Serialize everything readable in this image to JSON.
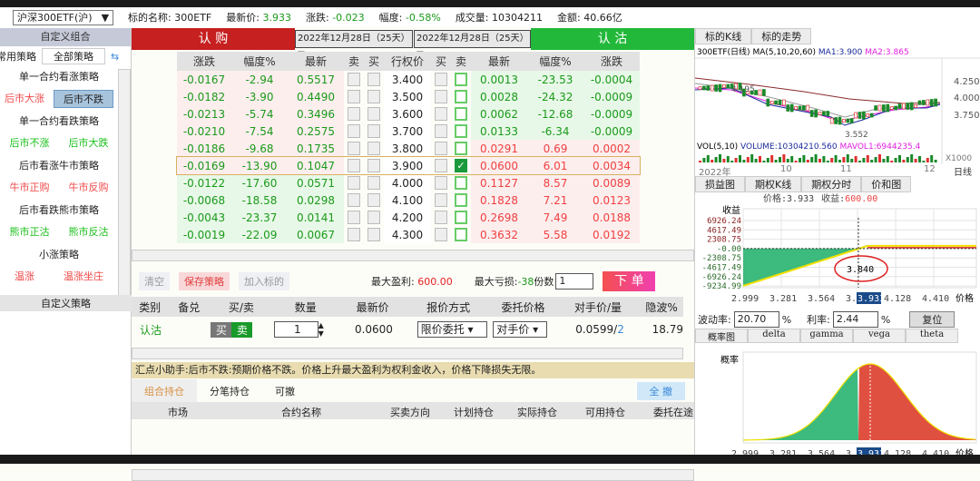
{
  "header": {
    "underlying_select": "沪深300ETF(沪)",
    "name_label": "标的名称:",
    "name": "300ETF",
    "last_label": "最新价:",
    "last": "3.933",
    "chg_label": "涨跌:",
    "chg": "-0.023",
    "pct_label": "幅度:",
    "pct": "-0.58%",
    "vol_label": "成交量:",
    "vol": "10304211",
    "amt_label": "金额:",
    "amt": "40.66亿"
  },
  "left": {
    "title": "自定义组合",
    "tabs": [
      "常用策略",
      "全部策略"
    ],
    "groups": [
      {
        "title": "单一合约看涨策略",
        "items": [
          "后市大涨",
          "后市不跌"
        ]
      },
      {
        "title": "单一合约看跌策略",
        "items": [
          "后市不涨",
          "后市大跌"
        ]
      },
      {
        "title": "后市看涨牛市策略",
        "items": [
          "牛市正购",
          "牛市反购"
        ]
      },
      {
        "title": "后市看跌熊市策略",
        "items": [
          "熊市正沽",
          "熊市反沽"
        ]
      },
      {
        "title": "小涨策略",
        "items": [
          "温涨",
          "温涨坐庄"
        ]
      }
    ],
    "selected": "后市不跌",
    "footer": "自定义策略"
  },
  "chain": {
    "call_label": "认 购",
    "put_label": "认 沽",
    "call_expiry": "2022年12月28日（25天）",
    "put_expiry": "2022年12月28日（25天）",
    "columns": [
      "涨跌",
      "幅度%",
      "最新",
      "卖",
      "买",
      "行权价",
      "买",
      "卖",
      "最新",
      "幅度%",
      "涨跌"
    ],
    "rows": [
      {
        "c_chg": "-0.0167",
        "c_pct": "-2.94",
        "c_last": "0.5517",
        "strike": "3.400",
        "p_last": "0.0013",
        "p_pct": "-23.53",
        "p_chg": "-0.0004"
      },
      {
        "c_chg": "-0.0182",
        "c_pct": "-3.90",
        "c_last": "0.4490",
        "strike": "3.500",
        "p_last": "0.0028",
        "p_pct": "-24.32",
        "p_chg": "-0.0009"
      },
      {
        "c_chg": "-0.0213",
        "c_pct": "-5.74",
        "c_last": "0.3496",
        "strike": "3.600",
        "p_last": "0.0062",
        "p_pct": "-12.68",
        "p_chg": "-0.0009"
      },
      {
        "c_chg": "-0.0210",
        "c_pct": "-7.54",
        "c_last": "0.2575",
        "strike": "3.700",
        "p_last": "0.0133",
        "p_pct": "-6.34",
        "p_chg": "-0.0009"
      },
      {
        "c_chg": "-0.0186",
        "c_pct": "-9.68",
        "c_last": "0.1735",
        "strike": "3.800",
        "p_last": "0.0291",
        "p_pct": "0.69",
        "p_chg": "0.0002"
      },
      {
        "c_chg": "-0.0169",
        "c_pct": "-13.90",
        "c_last": "0.1047",
        "strike": "3.900",
        "p_last": "0.0600",
        "p_pct": "6.01",
        "p_chg": "0.0034",
        "checked": true
      },
      {
        "c_chg": "-0.0122",
        "c_pct": "-17.60",
        "c_last": "0.0571",
        "strike": "4.000",
        "p_last": "0.1127",
        "p_pct": "8.57",
        "p_chg": "0.0089"
      },
      {
        "c_chg": "-0.0068",
        "c_pct": "-18.58",
        "c_last": "0.0298",
        "strike": "4.100",
        "p_last": "0.1828",
        "p_pct": "7.21",
        "p_chg": "0.0123"
      },
      {
        "c_chg": "-0.0043",
        "c_pct": "-23.37",
        "c_last": "0.0141",
        "strike": "4.200",
        "p_last": "0.2698",
        "p_pct": "7.49",
        "p_chg": "0.0188"
      },
      {
        "c_chg": "-0.0019",
        "c_pct": "-22.09",
        "c_last": "0.0067",
        "strike": "4.300",
        "p_last": "0.3632",
        "p_pct": "5.58",
        "p_chg": "0.0192"
      }
    ]
  },
  "actions": {
    "clear": "清空",
    "save": "保存策略",
    "add": "加入标的",
    "max_profit_label": "最大盈利:",
    "max_profit": "600.00",
    "max_loss_label": "最大亏损:",
    "max_loss": "-38",
    "qty_label": "份数",
    "qty": "1",
    "order": "下 单"
  },
  "order": {
    "columns": [
      "类别",
      "备兑",
      "买/卖",
      "数量",
      "最新价",
      "报价方式",
      "委托价格",
      "对手价/量",
      "隐波%"
    ],
    "row": {
      "type": "认沽",
      "buy": "买",
      "sell": "卖",
      "qty": "1",
      "last": "0.0600",
      "price_mode": "限价委托",
      "price": "对手价",
      "counter_price": "0.0599/",
      "counter_qty": "2",
      "iv": "18.79"
    }
  },
  "tip": "汇点小助手:后市不跌:预期价格不跌。价格上升最大盈利为权利金收入，价格下降损失无限。",
  "positions": {
    "tabs": [
      "组合持仓",
      "分笔持仓",
      "可撤"
    ],
    "cancel_all": "全 撤",
    "columns": [
      "市场",
      "合约名称",
      "买卖方向",
      "计划持仓",
      "实际持仓",
      "可用持仓",
      "委托在途"
    ]
  },
  "right": {
    "tabs": [
      "标的K线",
      "标的走势"
    ],
    "kline": {
      "title": "300ETF(日线)",
      "ma": "MA(5,10,20,60)",
      "ma1": "MA1:3.900",
      "ma2": "MA2:3.865",
      "high": "4.195",
      "low": "3.552",
      "yticks": [
        "4.250",
        "4.000",
        "3.750"
      ],
      "vol_title": "VOL(5,10)",
      "volume": "VOLUME:10304210.560",
      "mavol": "MAVOL1:6944235.4",
      "unit": "X1000",
      "xticks": [
        "2022年",
        "10",
        "11",
        "12"
      ],
      "period": "日线"
    },
    "chart_tabs": [
      "损益图",
      "期权K线",
      "期权分时",
      "价和图"
    ],
    "payoff": {
      "price_label": "价格:",
      "price": "3.933",
      "pnl_label": "收益:",
      "pnl": "600.00",
      "ylabel": "收益",
      "yticks": [
        "6926.24",
        "4617.49",
        "2308.75",
        "-0.00",
        "-2308.75",
        "-4617.49",
        "-6926.24",
        "-9234.99"
      ],
      "xticks": [
        "2.999",
        "3.281",
        "3.564",
        "3.",
        "4.128",
        "4.410"
      ],
      "current": "3.933",
      "xlabel": "价格",
      "breakeven": "3.840"
    },
    "vol_label": "波动率:",
    "vol": "20.70",
    "rate_label": "利率:",
    "rate": "2.44",
    "pct": "%",
    "reset": "复位",
    "greek_tabs": [
      "概率图",
      "delta",
      "gamma",
      "vega",
      "theta"
    ],
    "prob": {
      "ylabel": "概率",
      "xticks": [
        "2.999",
        "3.281",
        "3.564",
        "3.",
        "4.128",
        "4.410"
      ],
      "current": "3.933",
      "xlabel": "价格"
    },
    "colors": {
      "green": "#3dba7e",
      "red": "#e05040",
      "yellow": "#f0e000"
    }
  }
}
